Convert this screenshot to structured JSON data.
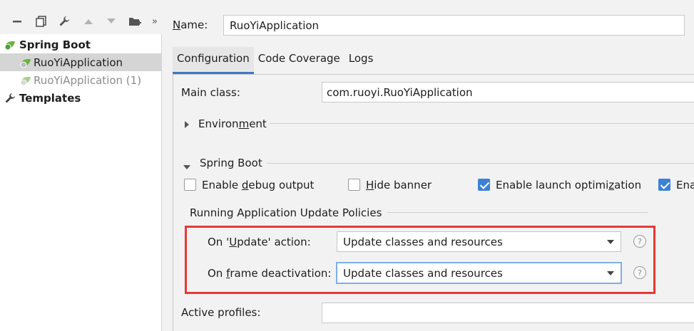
{
  "toolbar": {
    "buttons": [
      "minus-icon",
      "copy-icon",
      "wrench-icon",
      "arrow-up-icon",
      "arrow-down-icon",
      "add-folder-icon",
      "more-icon"
    ],
    "more_label": "»"
  },
  "tree": {
    "items": [
      {
        "label": "Spring Boot",
        "icon": "spring-boot-icon"
      },
      {
        "label": "RuoYiApplication",
        "icon": "spring-app-icon"
      },
      {
        "label": "RuoYiApplication (1)",
        "icon": "spring-app-icon"
      },
      {
        "label": "Templates",
        "icon": "wrench-icon"
      }
    ]
  },
  "name": {
    "label": "Name:",
    "value": "RuoYiApplication"
  },
  "tabs": [
    "Configuration",
    "Code Coverage",
    "Logs"
  ],
  "main_class": {
    "label": "Main class:",
    "value": "com.ruoyi.RuoYiApplication"
  },
  "environment": {
    "label": "Environment"
  },
  "spring_boot": {
    "label": "Spring Boot",
    "checkboxes": [
      {
        "label": "Enable debug output",
        "checked": false
      },
      {
        "label": "Hide banner",
        "checked": false
      },
      {
        "label": "Enable launch optimization",
        "checked": true
      },
      {
        "label": "Ena",
        "checked": true
      }
    ]
  },
  "policies": {
    "title": "Running Application Update Policies",
    "update_action": {
      "label": "On 'Update' action:",
      "value": "Update classes and resources"
    },
    "frame_deactivation": {
      "label": "On frame deactivation:",
      "value": "Update classes and resources"
    },
    "help": "?"
  },
  "active_profiles": {
    "label": "Active profiles:",
    "value": ""
  },
  "colors": {
    "accent": "#3b78c5",
    "highlight": "#e53935",
    "checkbox": "#3b82d6"
  }
}
